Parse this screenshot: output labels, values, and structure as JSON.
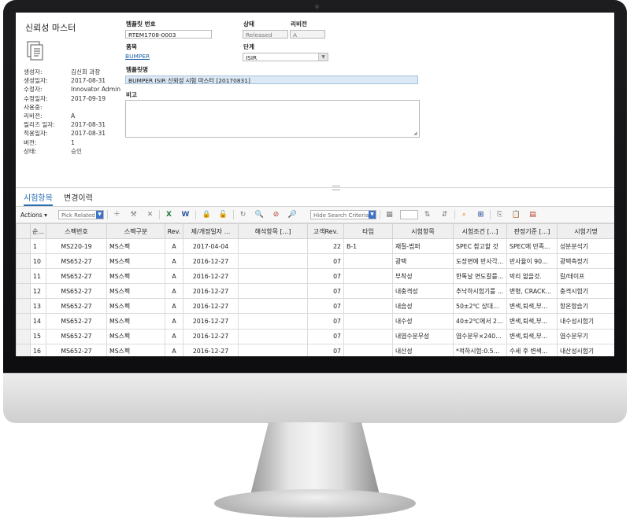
{
  "form": {
    "title": "신뢰성 마스터",
    "info": [
      {
        "k": "생성자:",
        "v": "김신희 과장"
      },
      {
        "k": "생성일자:",
        "v": "2017-08-31"
      },
      {
        "k": "수정자:",
        "v": "Innovator Admin"
      },
      {
        "k": "수정일자:",
        "v": "2017-09-19"
      },
      {
        "k": "사용중:",
        "v": ""
      },
      {
        "k": "리비전:",
        "v": "A"
      },
      {
        "k": "릴리즈 일자:",
        "v": "2017-08-31"
      },
      {
        "k": "적용일자:",
        "v": "2017-08-31"
      },
      {
        "k": "버전:",
        "v": "1"
      },
      {
        "k": "상태:",
        "v": "승인"
      }
    ],
    "template_no_label": "템플릿 번호",
    "template_no": "RTEM1708-0003",
    "status_label": "상태",
    "status": "Released",
    "revision_label": "리비전",
    "revision": "A",
    "item_label": "품목",
    "item": "BUMPER",
    "stage_label": "단계",
    "stage": "ISIR",
    "template_name_label": "템플릿명",
    "template_name": "BUMPER ISIR 신뢰성 시험 마스터 [20170831]",
    "note_label": "비고"
  },
  "tabs": [
    "시험항목",
    "변경이력"
  ],
  "toolbar": {
    "actions": "Actions",
    "pick_related": "Pick Related",
    "hide_search": "Hide Search Criteria"
  },
  "grid": {
    "headers": [
      "순...",
      "스펙번호",
      "스펙구분",
      "Rev.",
      "제/개정일자 ...",
      "해석항목 [...]",
      "고객Rev.",
      "타입",
      "시험항목",
      "시험조건 [...]",
      "판정기준 [...]",
      "시험기명"
    ],
    "rows": [
      [
        "1",
        "MS220-19",
        "MS스펙",
        "A",
        "2017-04-04",
        "",
        "22",
        "B-1",
        "재질-범퍼",
        "SPEC 참고할 것",
        "SPEC에 만족...",
        "성분분석기"
      ],
      [
        "10",
        "MS652-27",
        "MS스펙",
        "A",
        "2016-12-27",
        "",
        "07",
        "",
        "광택",
        "도장면에 반사각...",
        "반사율이 90...",
        "광택측정기"
      ],
      [
        "11",
        "MS652-27",
        "MS스펙",
        "A",
        "2016-12-27",
        "",
        "07",
        "",
        "부착성",
        "한톡날 면도칼를...",
        "박리 없을것.",
        "칼/테이프"
      ],
      [
        "12",
        "MS652-27",
        "MS스펙",
        "A",
        "2016-12-27",
        "",
        "07",
        "",
        "내충격성",
        "추낙하시험기를 ...",
        "변형, CRACK...",
        "충격시험기"
      ],
      [
        "13",
        "MS652-27",
        "MS스펙",
        "A",
        "2016-12-27",
        "",
        "07",
        "",
        "내습성",
        "50±2℃ 상대습...",
        "변색,퇴색,부...",
        "항온항습기"
      ],
      [
        "14",
        "MS652-27",
        "MS스펙",
        "A",
        "2016-12-27",
        "",
        "07",
        "",
        "내수성",
        "40±2℃에서 240...",
        "변색,퇴색,부...",
        "내수성시험기"
      ],
      [
        "15",
        "MS652-27",
        "MS스펙",
        "A",
        "2016-12-27",
        "",
        "07",
        "",
        "내염수분무성",
        "염수분무×240H...",
        "변색,퇴색,부...",
        "염수분무기"
      ],
      [
        "16",
        "MS652-27",
        "MS스펙",
        "A",
        "2016-12-27",
        "",
        "07",
        "",
        "내산성",
        "*적하시험:0.5%...",
        "수세 후 변색...",
        "내산성시험기"
      ]
    ]
  }
}
